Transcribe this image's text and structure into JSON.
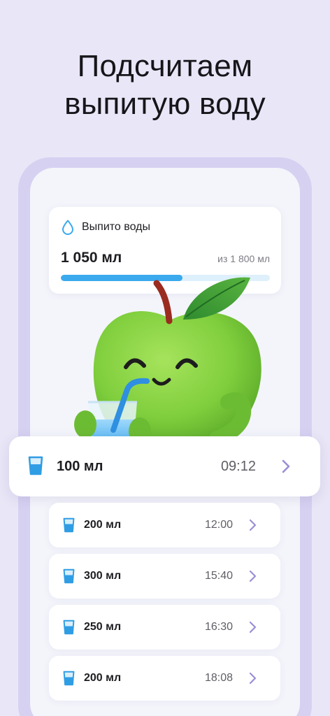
{
  "headline": {
    "line1": "Подсчитаем",
    "line2": "выпитую воду"
  },
  "water_card": {
    "title": "Выпито воды",
    "amount": "1 050 мл",
    "goal": "из 1 800 мл",
    "progress_fraction": 0.583,
    "icon": "water-drop-icon"
  },
  "entries": [
    {
      "volume": "100 мл",
      "time": "09:12"
    },
    {
      "volume": "200 мл",
      "time": "12:00"
    },
    {
      "volume": "300 мл",
      "time": "15:40"
    },
    {
      "volume": "250 мл",
      "time": "16:30"
    },
    {
      "volume": "200 мл",
      "time": "18:08"
    }
  ],
  "colors": {
    "background": "#e9e6f7",
    "accent_blue": "#3ba9ee",
    "chevron": "#9a8fd6",
    "apple_green": "#7fce3d"
  },
  "icons": {
    "cup": "water-glass-icon",
    "chevron": "chevron-right-icon",
    "mascot": "apple-mascot"
  }
}
